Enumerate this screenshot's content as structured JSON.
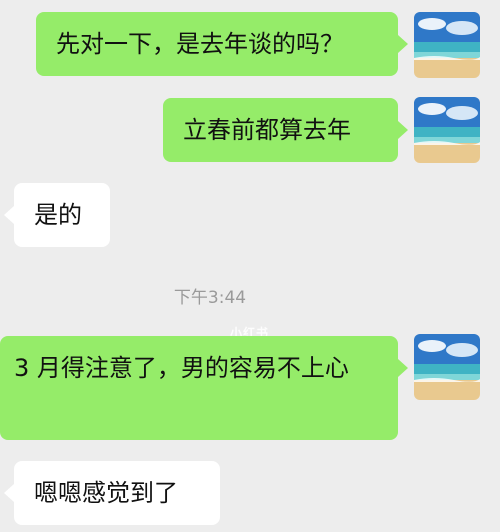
{
  "messages": [
    {
      "side": "me",
      "text": "先对一下，是去年谈的吗？"
    },
    {
      "side": "me",
      "text": "立春前都算去年"
    },
    {
      "side": "other",
      "text": "是的"
    },
    {
      "side": "me",
      "text": "3 月得注意了，男的容易不上心"
    },
    {
      "side": "other",
      "text": "嗯嗯感觉到了"
    }
  ],
  "timestamp": "下午3:44",
  "watermark": "小红书",
  "avatar_icon": "beach-sky-avatar",
  "colors": {
    "me_bubble": "#95ec69",
    "other_bubble": "#ffffff",
    "background": "#ededed"
  }
}
